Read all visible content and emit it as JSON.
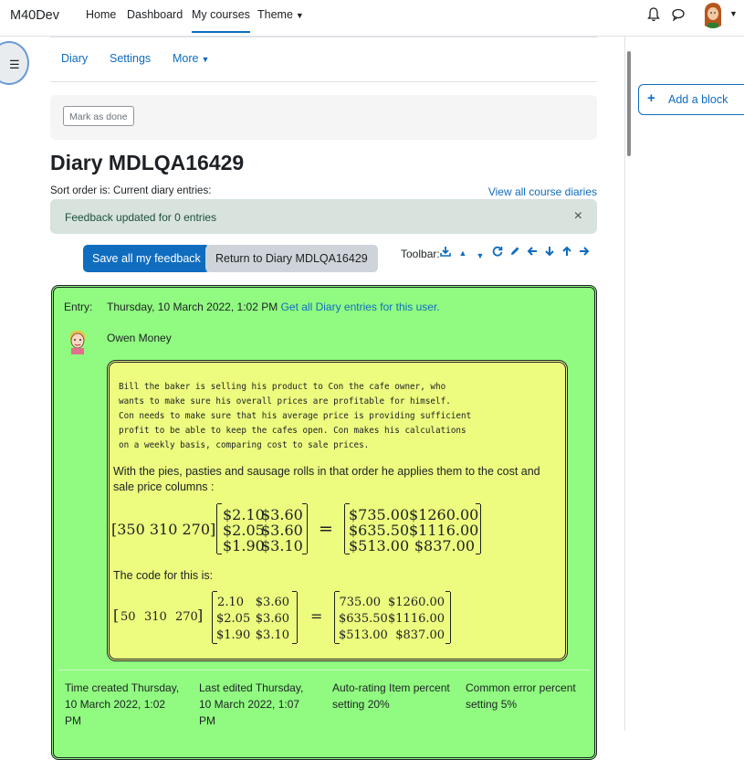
{
  "topbar": {
    "brand": "M40Dev",
    "nav": [
      "Home",
      "Dashboard",
      "My courses",
      "Theme"
    ],
    "active": "My courses"
  },
  "secondary_nav": [
    "Diary",
    "Settings",
    "More"
  ],
  "mark_done": "Mark as done",
  "page_title": "Diary MDLQA16429",
  "sort_order": "Sort order is: Current diary entries:",
  "view_all": "View all course diaries",
  "alert": "Feedback updated for 0 entries",
  "buttons": {
    "save": "Save all my feedback",
    "return": "Return to Diary MDLQA16429"
  },
  "toolbar_label": "Toolbar:",
  "entry": {
    "label": "Entry:",
    "date": "Thursday, 10 March 2022, 1:02 PM",
    "link": "Get all Diary entries for this user.",
    "user": "Owen Money",
    "mono": "Bill the baker is selling his product to Con the cafe owner, who\nwants to make sure his overall prices are profitable for himself.\nCon needs to make sure that his average price is providing sufficient\nprofit to be able to keep the cafes open. Con makes his calculations\non a weekly basis, comparing cost to sale prices.",
    "para": "With the pies, pasties and sausage rolls in that order he applies them to the cost and sale price columns :",
    "code_label": "The code for this is:",
    "matrix1": {
      "row": "[350 310 270]",
      "cost": [
        [
          "$2.10",
          "$3.60"
        ],
        [
          "$2.05",
          "$3.60"
        ],
        [
          "$1.90",
          "$3.10"
        ]
      ],
      "result": [
        [
          "$735.00",
          "$1260.00"
        ],
        [
          "$635.50",
          "$1116.00"
        ],
        [
          "$513.00",
          "$837.00"
        ]
      ]
    },
    "matrix2": {
      "row": [
        "50",
        "310",
        "270"
      ],
      "cost": [
        [
          "2.10",
          "$3.60"
        ],
        [
          "$2.05",
          "$3.60"
        ],
        [
          "$1.90",
          "$3.10"
        ]
      ],
      "result": [
        [
          "735.00",
          "$1260.00"
        ],
        [
          "$635.50",
          "$1116.00"
        ],
        [
          "$513.00",
          "$837.00"
        ]
      ]
    }
  },
  "meta": {
    "created": "Time created Thursday, 10 March 2022, 1:02 PM",
    "edited": "Last edited Thursday, 10 March 2022, 1:07 PM",
    "autorating": "Auto-rating Item percent setting 20%",
    "error": "Common error percent setting 5%"
  },
  "add_block": "Add a block"
}
